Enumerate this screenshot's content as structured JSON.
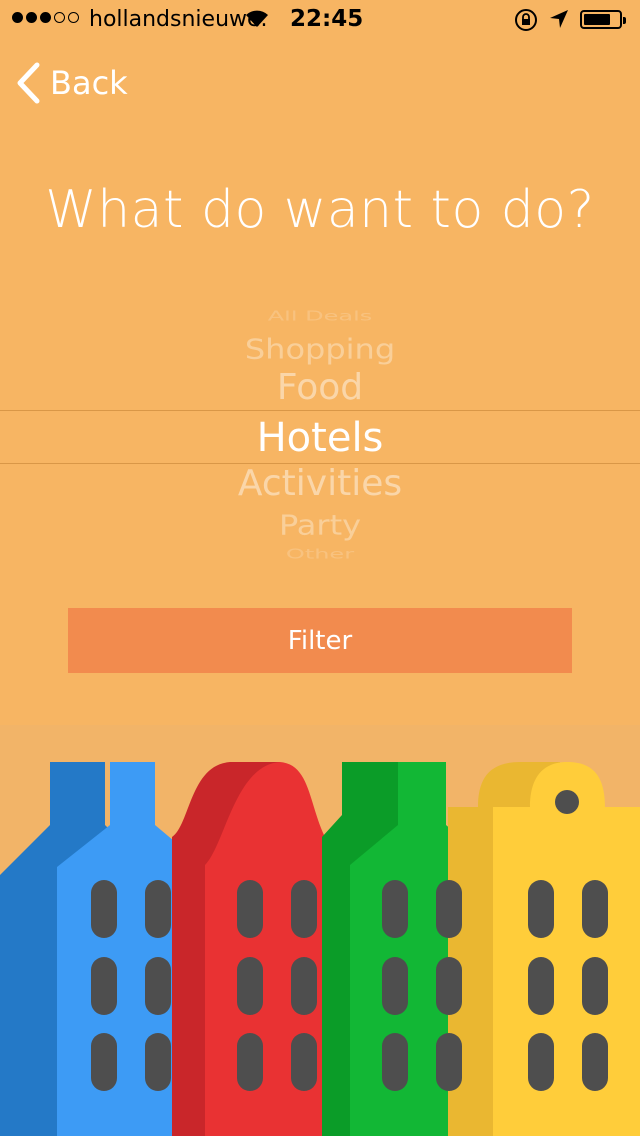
{
  "status_bar": {
    "signal_dots": [
      "on",
      "on",
      "on",
      "off",
      "off"
    ],
    "carrier": "hollandsnieuwe.",
    "time": "22:45"
  },
  "nav": {
    "back_label": "Back"
  },
  "question": "What do want to do?",
  "picker": {
    "options": [
      "All Deals",
      "Shopping",
      "Food",
      "Hotels",
      "Activities",
      "Party",
      "Other"
    ],
    "selected": "Hotels"
  },
  "filter_button": {
    "label": "Filter"
  },
  "colors": {
    "background": "#F7B563",
    "button": "#F28B4E",
    "building_blue": "#3D9BF5",
    "building_red": "#E93233",
    "building_green": "#12B735",
    "building_yellow": "#FFCD3A",
    "window": "#4E4E4E"
  }
}
